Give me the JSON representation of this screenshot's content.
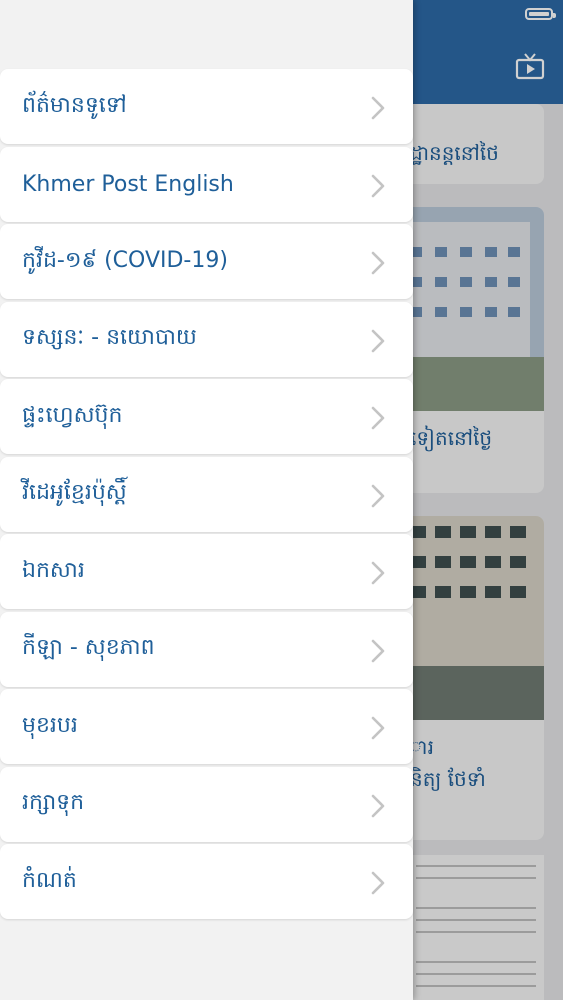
{
  "colors": {
    "accent": "#1f5f99",
    "header": "#2c6aa6",
    "chevron": "#c4c4c4"
  },
  "drawer": {
    "items": [
      {
        "label": "ព័ត៌មានទូទៅ",
        "icon": "chevron-right-icon"
      },
      {
        "label": "Khmer Post English",
        "icon": "chevron-right-icon"
      },
      {
        "label": "កូវីដ-១៩ (COVID-19)",
        "icon": "chevron-right-icon"
      },
      {
        "label": "ទស្សនៈ - នយោបាយ",
        "icon": "chevron-right-icon"
      },
      {
        "label": "ផ្ទះហ្វេសប៊ុក",
        "icon": "chevron-right-icon"
      },
      {
        "label": "វីដេអូខ្មែរប៉ុស្តិ៍",
        "icon": "chevron-right-icon"
      },
      {
        "label": "ឯកសារ",
        "icon": "chevron-right-icon"
      },
      {
        "label": "កីឡា - សុខភាព",
        "icon": "chevron-right-icon"
      },
      {
        "label": "មុខរបរ",
        "icon": "chevron-right-icon"
      },
      {
        "label": "រក្សាទុក",
        "icon": "chevron-right-icon"
      },
      {
        "label": "កំណត់",
        "icon": "chevron-right-icon"
      }
    ]
  },
  "background": {
    "header_icons": [
      "battery-icon",
      "tv-icon"
    ],
    "card_captions": [
      "ដ្ឋានន្តនៅថៃ",
      "ទៀតនៅថ្ងៃ",
      "ារ",
      "និត្យ ថែទាំ"
    ]
  }
}
